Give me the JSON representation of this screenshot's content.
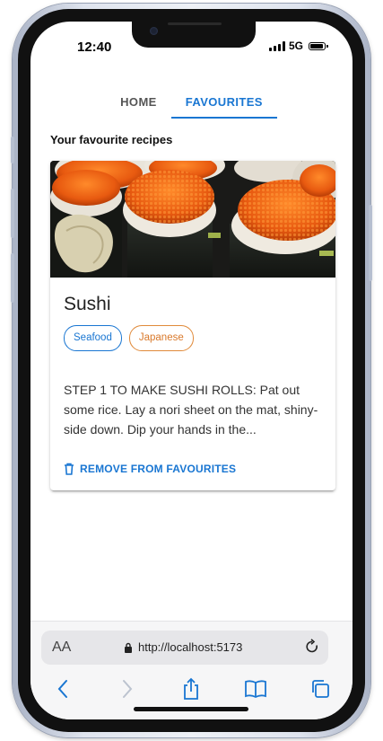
{
  "status": {
    "time": "12:40",
    "network": "5G"
  },
  "nav": {
    "tabs": [
      {
        "label": "HOME",
        "active": false
      },
      {
        "label": "FAVOURITES",
        "active": true
      }
    ]
  },
  "favourites": {
    "title": "Your favourite recipes",
    "recipes": [
      {
        "name": "Sushi",
        "tags": [
          "Seafood",
          "Japanese"
        ],
        "description": "STEP 1 TO MAKE SUSHI ROLLS: Pat out some rice. Lay a nori sheet on the mat, shiny-side down. Dip your hands in the...",
        "action_label": "REMOVE FROM FAVOURITES"
      }
    ]
  },
  "browser": {
    "text_size_label": "AA",
    "url": "http://localhost:5173"
  },
  "colors": {
    "accent": "#1976d2",
    "seafood_tag": "#1976d2",
    "japanese_tag": "#d9792b"
  }
}
